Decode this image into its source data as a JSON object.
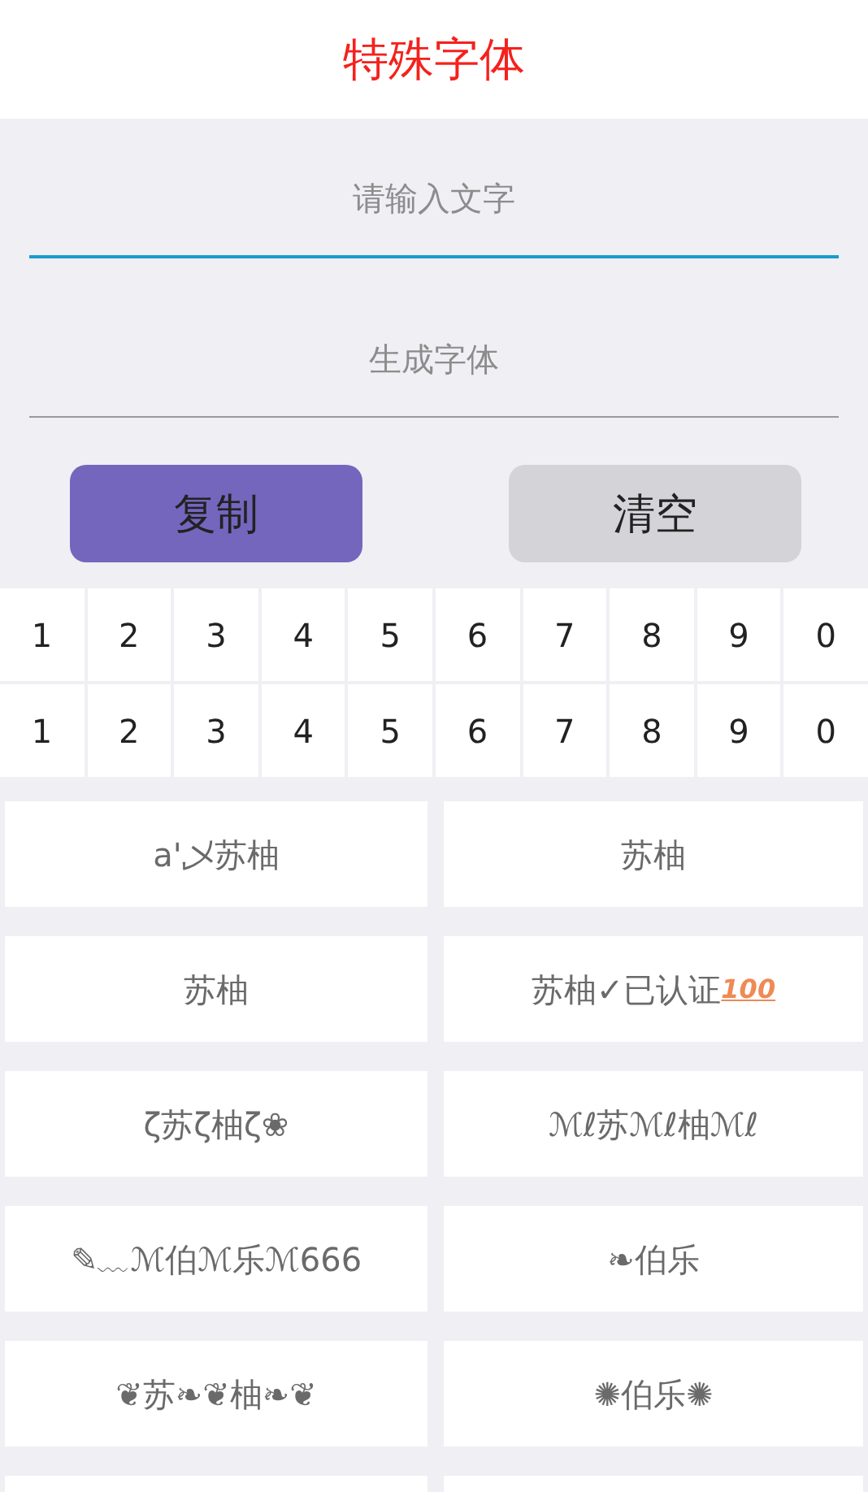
{
  "title": "特殊字体",
  "input": {
    "placeholder": "请输入文字"
  },
  "output": {
    "placeholder": "生成字体"
  },
  "buttons": [
    {
      "label": "复制",
      "kind": "primary"
    },
    {
      "label": "清空",
      "kind": "secondary"
    }
  ],
  "digit_rows": [
    [
      "1",
      "2",
      "3",
      "4",
      "5",
      "6",
      "7",
      "8",
      "9",
      "0"
    ],
    [
      "1",
      "2",
      "3",
      "4",
      "5",
      "6",
      "7",
      "8",
      "9",
      "0"
    ]
  ],
  "styles": [
    {
      "text": "a'乄苏柚"
    },
    {
      "text": "苏柚"
    },
    {
      "text": "苏柚"
    },
    {
      "text": "苏柚✓已认证",
      "badge": "100"
    },
    {
      "text": "ζ苏ζ柚ζ❀"
    },
    {
      "text": "ℳℓ苏ℳℓ柚ℳℓ"
    },
    {
      "text": "✎﹏ℳ伯ℳ乐ℳ666"
    },
    {
      "text": "❧伯乐"
    },
    {
      "text": "❦苏❧❦柚❧❦"
    },
    {
      "text": "✺伯乐✺"
    }
  ]
}
